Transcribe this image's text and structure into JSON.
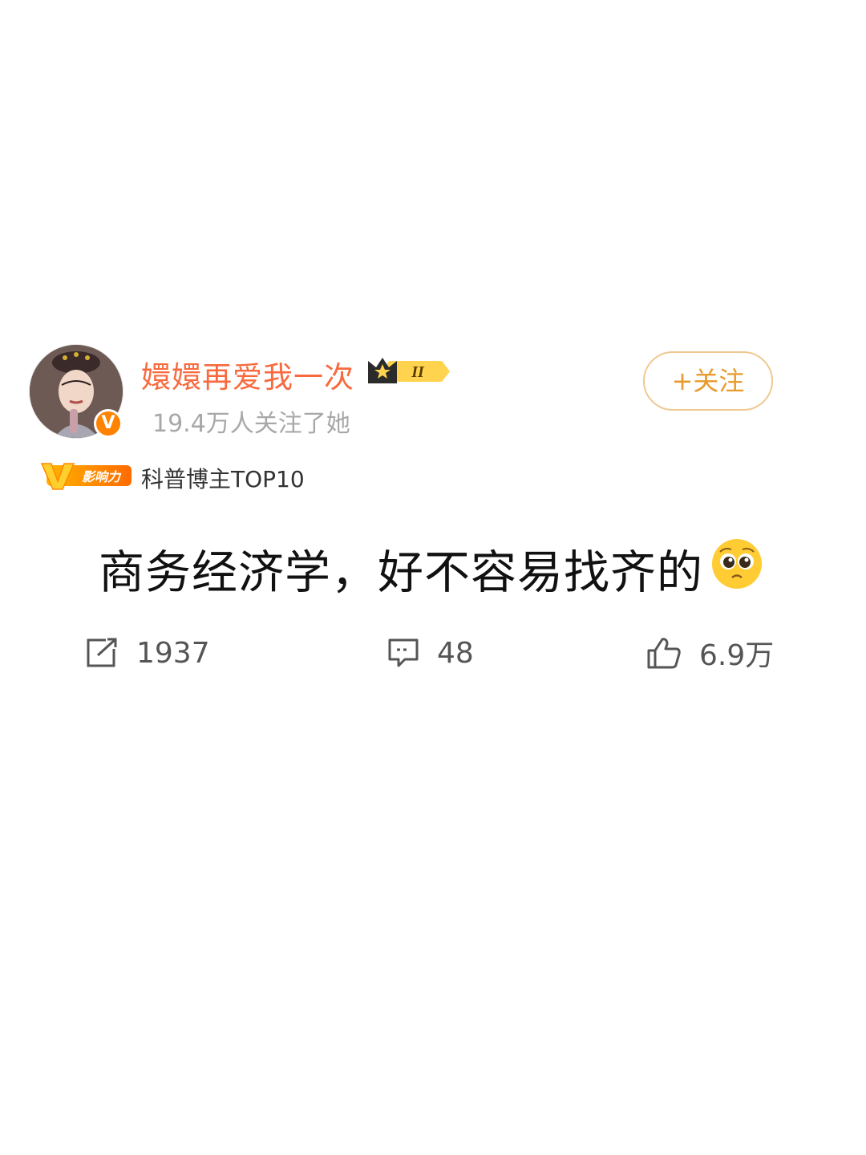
{
  "user": {
    "name": "嬛嬛再爱我一次",
    "followers_text": "19.4万人关注了她",
    "verified_mark": "V",
    "level_badge": "II"
  },
  "follow_button": {
    "label": "+关注"
  },
  "influence": {
    "badge_label": "影响力",
    "text": "科普博主TOP10"
  },
  "post": {
    "text": "商务经济学，好不容易找齐的",
    "emoji": "pleading-face"
  },
  "stats": {
    "reposts": "1937",
    "comments": "48",
    "likes": "6.9万"
  },
  "colors": {
    "username": "#f86a3e",
    "follow_accent": "#e99a2c",
    "verified": "#ff8200",
    "muted": "#a8a8a8"
  }
}
